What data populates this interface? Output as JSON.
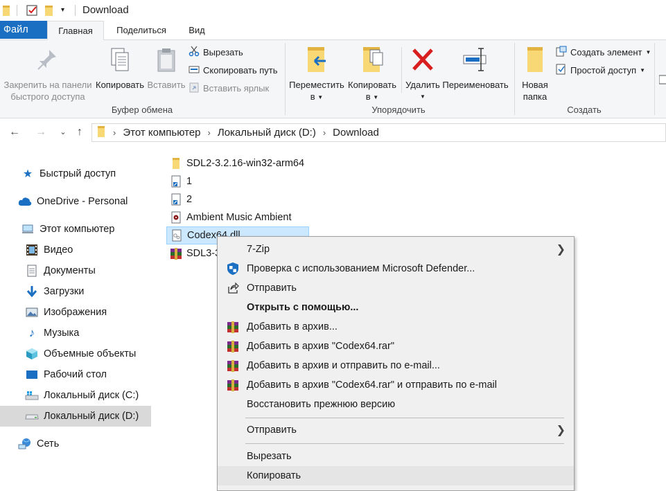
{
  "window": {
    "title": "Download"
  },
  "tabs": {
    "file": "Файл",
    "home": "Главная",
    "share": "Поделиться",
    "view": "Вид"
  },
  "ribbon": {
    "clipboard": {
      "pin": "Закрепить на панели\nбыстрого доступа",
      "pin_line1": "Закрепить на панели",
      "pin_line2": "быстрого доступа",
      "copy": "Копировать",
      "paste": "Вставить",
      "cut": "Вырезать",
      "copy_path": "Скопировать путь",
      "paste_shortcut": "Вставить ярлык",
      "group_label": "Буфер обмена"
    },
    "organize": {
      "move_line1": "Переместить",
      "move_line2": "в",
      "copy_line1": "Копировать",
      "copy_line2": "в",
      "delete": "Удалить",
      "rename": "Переименовать",
      "group_label": "Упорядочить"
    },
    "create": {
      "new_folder_line1": "Новая",
      "new_folder_line2": "папка",
      "new_item": "Создать элемент",
      "easy_access": "Простой доступ",
      "group_label": "Создать"
    }
  },
  "address": {
    "crumbs": [
      "Этот компьютер",
      "Локальный диск (D:)",
      "Download"
    ]
  },
  "nav": {
    "quick_access": "Быстрый доступ",
    "onedrive": "OneDrive - Personal",
    "this_pc": "Этот компьютер",
    "items": [
      "Видео",
      "Документы",
      "Загрузки",
      "Изображения",
      "Музыка",
      "Объемные объекты",
      "Рабочий стол",
      "Локальный диск (C:)",
      "Локальный диск (D:)"
    ],
    "network": "Сеть"
  },
  "files": [
    "SDL2-3.2.16-win32-arm64",
    "1",
    "2",
    "Ambient Music Ambient",
    "Codex64.dll",
    "SDL3-3"
  ],
  "context_menu": {
    "items": [
      "7-Zip",
      "Проверка с использованием Microsoft Defender...",
      "Отправить",
      "Открыть с помощью...",
      "Добавить в архив...",
      "Добавить в архив \"Codex64.rar\"",
      "Добавить в архив и отправить по e-mail...",
      "Добавить в архив \"Codex64.rar\" и отправить по e-mail",
      "Восстановить прежнюю версию",
      "Отправить",
      "Вырезать",
      "Копировать"
    ]
  },
  "colors": {
    "accent": "#1a6fc2",
    "selection": "#cce8ff",
    "folder": "#f8d775",
    "delete_red": "#d81e1e"
  }
}
